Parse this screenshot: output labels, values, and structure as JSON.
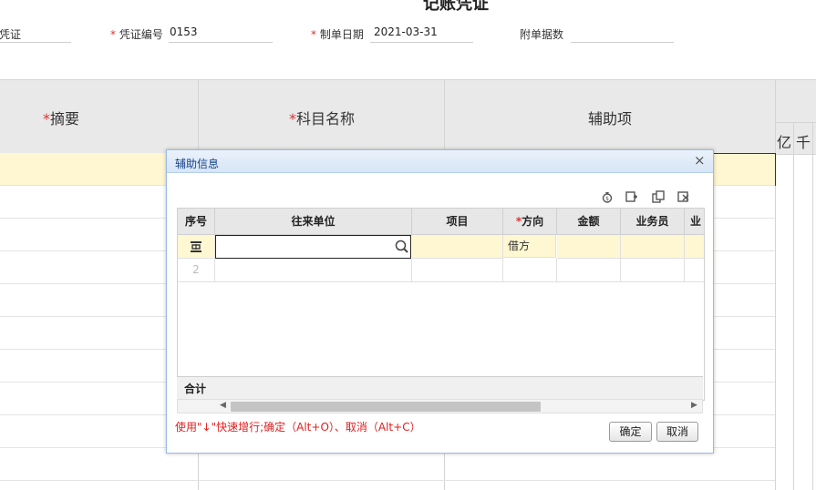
{
  "page": {
    "title": "记账凭证"
  },
  "header": {
    "voucher_type_label": "凭证",
    "voucher_no_label": "凭证编号",
    "voucher_no_value": "0153",
    "date_label": "制单日期",
    "date_value": "2021-03-31",
    "attachments_label": "附单据数",
    "required_mark": "*"
  },
  "grid": {
    "col_summary": "摘要",
    "col_account": "科目名称",
    "col_aux": "辅助项",
    "unit_yi": "亿",
    "unit_qian": "千"
  },
  "dialog": {
    "title": "辅助信息",
    "close_glyph": "×",
    "columns": [
      "序号",
      "往来单位",
      "项目",
      "方向",
      "金额",
      "业务员",
      "业"
    ],
    "rows": [
      {
        "index_icon": "row-insert-icon",
        "partner": "",
        "project": "",
        "direction": "借方",
        "amount": "",
        "salesperson": ""
      },
      {
        "index": "2",
        "partner": "",
        "project": "",
        "direction": "",
        "amount": "",
        "salesperson": ""
      }
    ],
    "total_label": "合计",
    "hint": "使用\"↓\"快速增行;确定（Alt+O）、取消（Alt+C）",
    "ok_label": "确定",
    "cancel_label": "取消",
    "scroll_left": "◀",
    "scroll_right": "▶"
  },
  "colors": {
    "highlight_row": "#fff7d1",
    "required": "#e03030",
    "dialog_border": "#99bbe8"
  }
}
